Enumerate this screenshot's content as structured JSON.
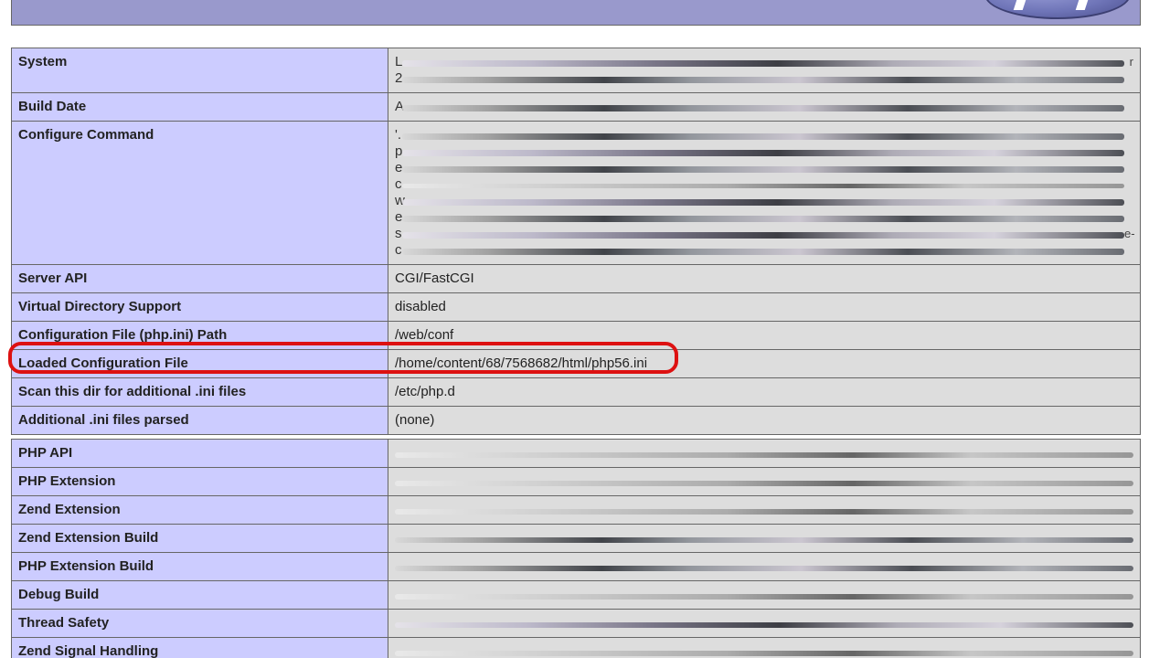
{
  "rows": [
    {
      "key": "System",
      "value_lead": [
        "L",
        "2"
      ],
      "value_tail": "r"
    },
    {
      "key": "Build Date",
      "value_lead": [
        "A"
      ]
    },
    {
      "key": "Configure Command",
      "value_lead": [
        "'.",
        "p",
        "e",
        "c",
        "w",
        "e",
        "s",
        "c"
      ],
      "value_tail": "e-"
    },
    {
      "key": "Server API",
      "value": "CGI/FastCGI"
    },
    {
      "key": "Virtual Directory Support",
      "value": "disabled"
    },
    {
      "key": "Configuration File (php.ini) Path",
      "value": "/web/conf"
    },
    {
      "key": "Loaded Configuration File",
      "value": "/home/content/68/7568682/html/php56.ini"
    },
    {
      "key": "Scan this dir for additional .ini files",
      "value": "/etc/php.d"
    },
    {
      "key": "Additional .ini files parsed",
      "value": "(none)"
    },
    {
      "key": "PHP API"
    },
    {
      "key": "PHP Extension"
    },
    {
      "key": "Zend Extension"
    },
    {
      "key": "Zend Extension Build"
    },
    {
      "key": "PHP Extension Build"
    },
    {
      "key": "Debug Build"
    },
    {
      "key": "Thread Safety"
    },
    {
      "key": "Zend Signal Handling"
    }
  ],
  "colors": {
    "header_bg": "#9999cc",
    "key_bg": "#ccccff",
    "value_bg": "#dddddd",
    "callout": "#dd1111"
  },
  "icons": {
    "logo": "php-logo-icon"
  }
}
